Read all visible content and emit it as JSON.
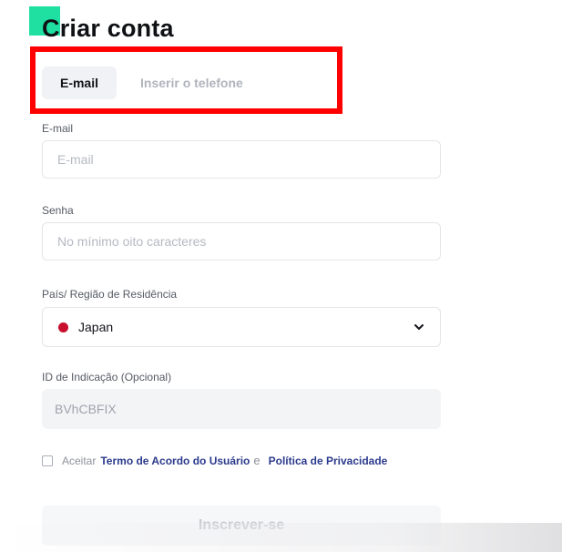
{
  "header": {
    "title": "Criar conta"
  },
  "tabs": [
    {
      "label": "E-mail",
      "active": true
    },
    {
      "label": "Inserir o telefone",
      "active": false
    }
  ],
  "form": {
    "email": {
      "label": "E-mail",
      "placeholder": "E-mail",
      "value": ""
    },
    "password": {
      "label": "Senha",
      "placeholder": "No mínimo oito caracteres",
      "value": ""
    },
    "country": {
      "label": "País/ Região de Residência",
      "value": "Japan",
      "flag_icon": "japan-flag-icon"
    },
    "referral": {
      "label": "ID de Indicação (Opcional)",
      "value": "BVhCBFIX"
    },
    "terms": {
      "prefix": "Aceitar",
      "link1": "Termo de Acordo do Usuário",
      "conjunction": "e",
      "link2": "Política de Privacidade",
      "checked": false
    },
    "submit_label": "Inscrever-se"
  },
  "colors": {
    "brand_accent": "#1fe0a0",
    "highlight": "#ff0000",
    "link": "#2b3a8c"
  }
}
